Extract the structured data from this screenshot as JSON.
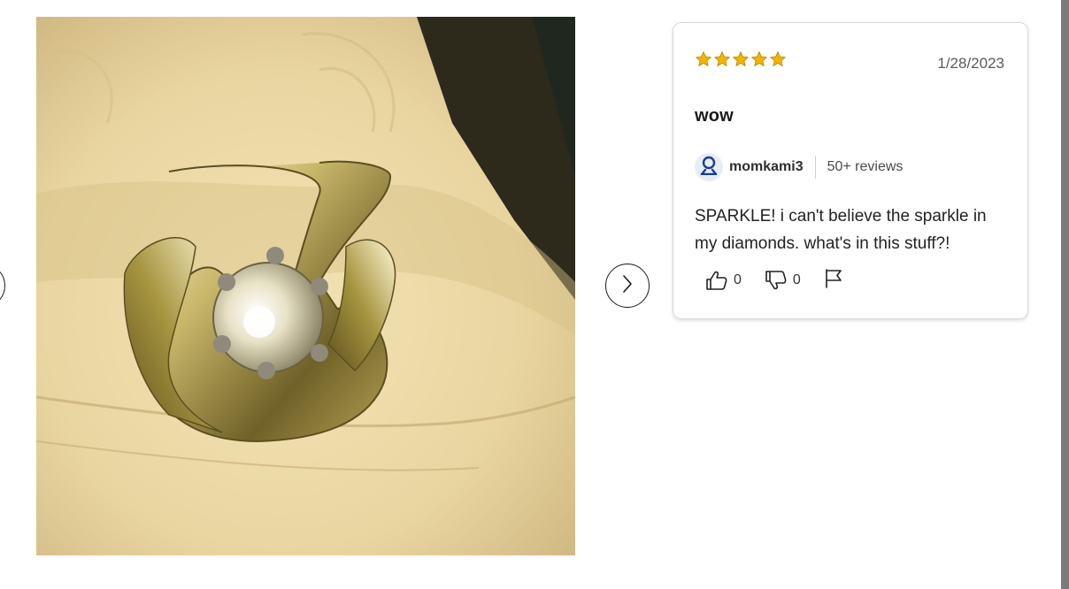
{
  "carousel": {
    "prev_label": "Previous",
    "next_label": "Next"
  },
  "photo": {
    "alt": "Diamond ring on finger"
  },
  "review": {
    "rating": 5,
    "rating_max": 5,
    "date": "1/28/2023",
    "title": "wow",
    "reviewer": {
      "name": "momkami3",
      "review_count": "50+ reviews"
    },
    "body": "SPARKLE! i can't believe the sparkle in my diamonds. what's in this stuff?!",
    "helpful_count": "0",
    "unhelpful_count": "0"
  },
  "colors": {
    "star": "#f5b301",
    "avatar_icon": "#1d3c8f",
    "border": "#d9d9d9"
  },
  "icons": {
    "star": "star-icon",
    "user": "user-icon",
    "thumbs_up": "thumbs-up-icon",
    "thumbs_down": "thumbs-down-icon",
    "flag": "flag-icon",
    "chevron_left": "chevron-left-icon",
    "chevron_right": "chevron-right-icon"
  }
}
